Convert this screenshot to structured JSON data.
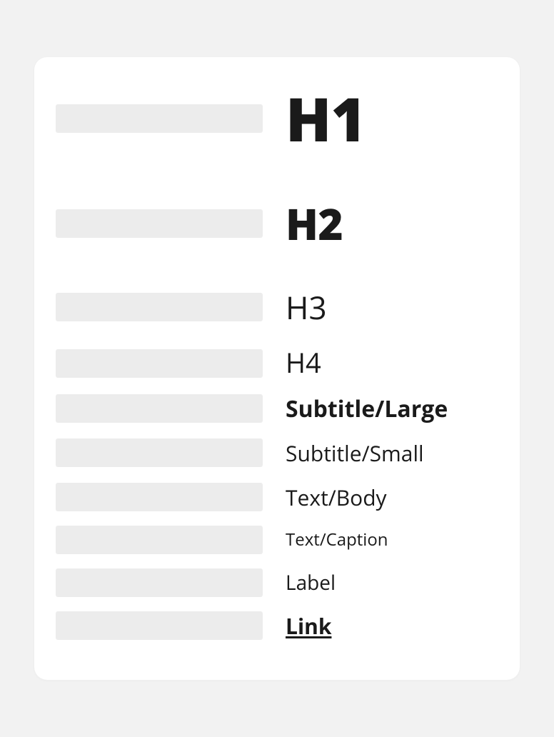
{
  "typography": [
    {
      "label": "H1"
    },
    {
      "label": "H2"
    },
    {
      "label": "H3"
    },
    {
      "label": "H4"
    },
    {
      "label": "Subtitle/Large"
    },
    {
      "label": "Subtitle/Small"
    },
    {
      "label": "Text/Body"
    },
    {
      "label": "Text/Caption"
    },
    {
      "label": "Label"
    },
    {
      "label": "Link"
    }
  ]
}
